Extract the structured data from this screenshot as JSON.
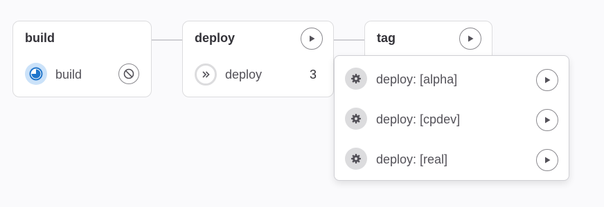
{
  "colors": {
    "accent": "#1f75cb",
    "border": "#dcdcde",
    "muted_icon": "#737278"
  },
  "pipeline": {
    "stages": [
      {
        "title": "build",
        "jobs": [
          {
            "name": "build",
            "status_icon": "running-icon",
            "action_icon": "cancel-icon"
          }
        ]
      },
      {
        "title": "deploy",
        "action_icon": "play-icon",
        "jobs": [
          {
            "name": "deploy",
            "status_icon": "skipped-icon",
            "count": "3"
          }
        ]
      },
      {
        "title": "tag",
        "action_icon": "play-icon"
      }
    ],
    "dropdown": {
      "items": [
        {
          "name": "deploy: [alpha]",
          "status_icon": "manual-gear-icon",
          "action_icon": "play-icon"
        },
        {
          "name": "deploy: [cpdev]",
          "status_icon": "manual-gear-icon",
          "action_icon": "play-icon"
        },
        {
          "name": "deploy: [real]",
          "status_icon": "manual-gear-icon",
          "action_icon": "play-icon"
        }
      ]
    }
  }
}
